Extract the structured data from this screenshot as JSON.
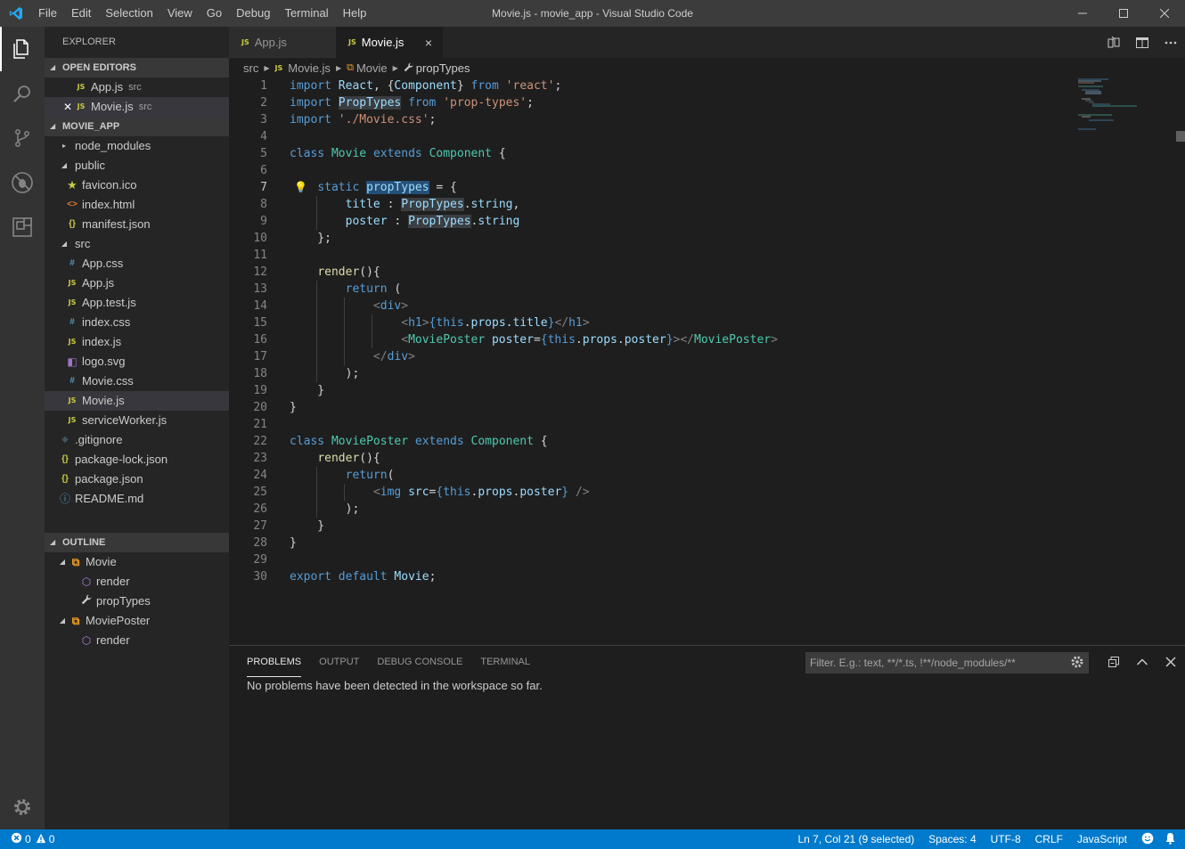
{
  "window": {
    "title": "Movie.js - movie_app - Visual Studio Code",
    "menu": [
      "File",
      "Edit",
      "Selection",
      "View",
      "Go",
      "Debug",
      "Terminal",
      "Help"
    ],
    "controls": [
      "minimize-icon",
      "maximize-icon",
      "close-icon"
    ]
  },
  "activity_bar": {
    "items": [
      "files-icon",
      "search-icon",
      "source-control-icon",
      "debug-icon",
      "extensions-icon"
    ],
    "settings": "gear-icon"
  },
  "sidebar": {
    "title": "EXPLORER",
    "open_editors": {
      "header": "OPEN EDITORS",
      "items": [
        {
          "icon": "JS",
          "name": "App.js",
          "desc": "src"
        },
        {
          "icon": "JS",
          "name": "Movie.js",
          "desc": "src"
        }
      ]
    },
    "project": {
      "header": "MOVIE_APP",
      "items": [
        {
          "twistie": "▸",
          "icon": "",
          "name": "node_modules"
        },
        {
          "twistie": "◢",
          "icon": "",
          "name": "public"
        },
        {
          "twistie": "",
          "icon": "★",
          "name": "favicon.ico"
        },
        {
          "twistie": "",
          "icon": "<>",
          "name": "index.html"
        },
        {
          "twistie": "",
          "icon": "{}",
          "name": "manifest.json"
        },
        {
          "twistie": "◢",
          "icon": "",
          "name": "src"
        },
        {
          "twistie": "",
          "icon": "#",
          "name": "App.css"
        },
        {
          "twistie": "",
          "icon": "JS",
          "name": "App.js"
        },
        {
          "twistie": "",
          "icon": "JS",
          "name": "App.test.js"
        },
        {
          "twistie": "",
          "icon": "#",
          "name": "index.css"
        },
        {
          "twistie": "",
          "icon": "JS",
          "name": "index.js"
        },
        {
          "twistie": "",
          "icon": "◧",
          "name": "logo.svg"
        },
        {
          "twistie": "",
          "icon": "#",
          "name": "Movie.css"
        },
        {
          "twistie": "",
          "icon": "JS",
          "name": "Movie.js"
        },
        {
          "twistie": "",
          "icon": "JS",
          "name": "serviceWorker.js"
        },
        {
          "twistie": "",
          "icon": "◆",
          "name": ".gitignore"
        },
        {
          "twistie": "",
          "icon": "{}",
          "name": "package-lock.json"
        },
        {
          "twistie": "",
          "icon": "{}",
          "name": "package.json"
        },
        {
          "twistie": "",
          "icon": "ⓘ",
          "name": "README.md"
        }
      ]
    },
    "outline": {
      "header": "OUTLINE",
      "items": [
        {
          "twistie": "◢",
          "icon": "⧉",
          "name": "Movie"
        },
        {
          "twistie": "",
          "icon": "⬡",
          "name": "render"
        },
        {
          "twistie": "",
          "icon": "🔧",
          "name": "propTypes"
        },
        {
          "twistie": "◢",
          "icon": "⧉",
          "name": "MoviePoster"
        },
        {
          "twistie": "",
          "icon": "⬡",
          "name": "render"
        }
      ]
    }
  },
  "tabs": [
    {
      "icon": "JS",
      "label": "App.js"
    },
    {
      "icon": "JS",
      "label": "Movie.js",
      "close": "×"
    }
  ],
  "breadcrumb": {
    "items": [
      "src",
      "Movie.js",
      "Movie",
      "propTypes"
    ],
    "icons": {
      "file": "JS"
    }
  },
  "editor": {
    "line_numbers": [
      "1",
      "2",
      "3",
      "4",
      "5",
      "6",
      "7",
      "8",
      "9",
      "10",
      "11",
      "12",
      "13",
      "14",
      "15",
      "16",
      "17",
      "18",
      "19",
      "20",
      "21",
      "22",
      "23",
      "24",
      "25",
      "26",
      "27",
      "28",
      "29",
      "30"
    ]
  },
  "panel": {
    "tabs": [
      "PROBLEMS",
      "OUTPUT",
      "DEBUG CONSOLE",
      "TERMINAL"
    ],
    "filter_placeholder": "Filter. E.g.: text, **/*.ts, !**/node_modules/**",
    "message": "No problems have been detected in the workspace so far."
  },
  "status_bar": {
    "errors": "0",
    "warnings": "0",
    "position": "Ln 7, Col 21 (9 selected)",
    "spaces": "Spaces: 4",
    "encoding": "UTF-8",
    "eol": "CRLF",
    "language": "JavaScript"
  },
  "colors": {
    "accent": "#007acc",
    "keyword": "#569cd6",
    "type": "#4ec9b0",
    "string": "#ce9178"
  }
}
